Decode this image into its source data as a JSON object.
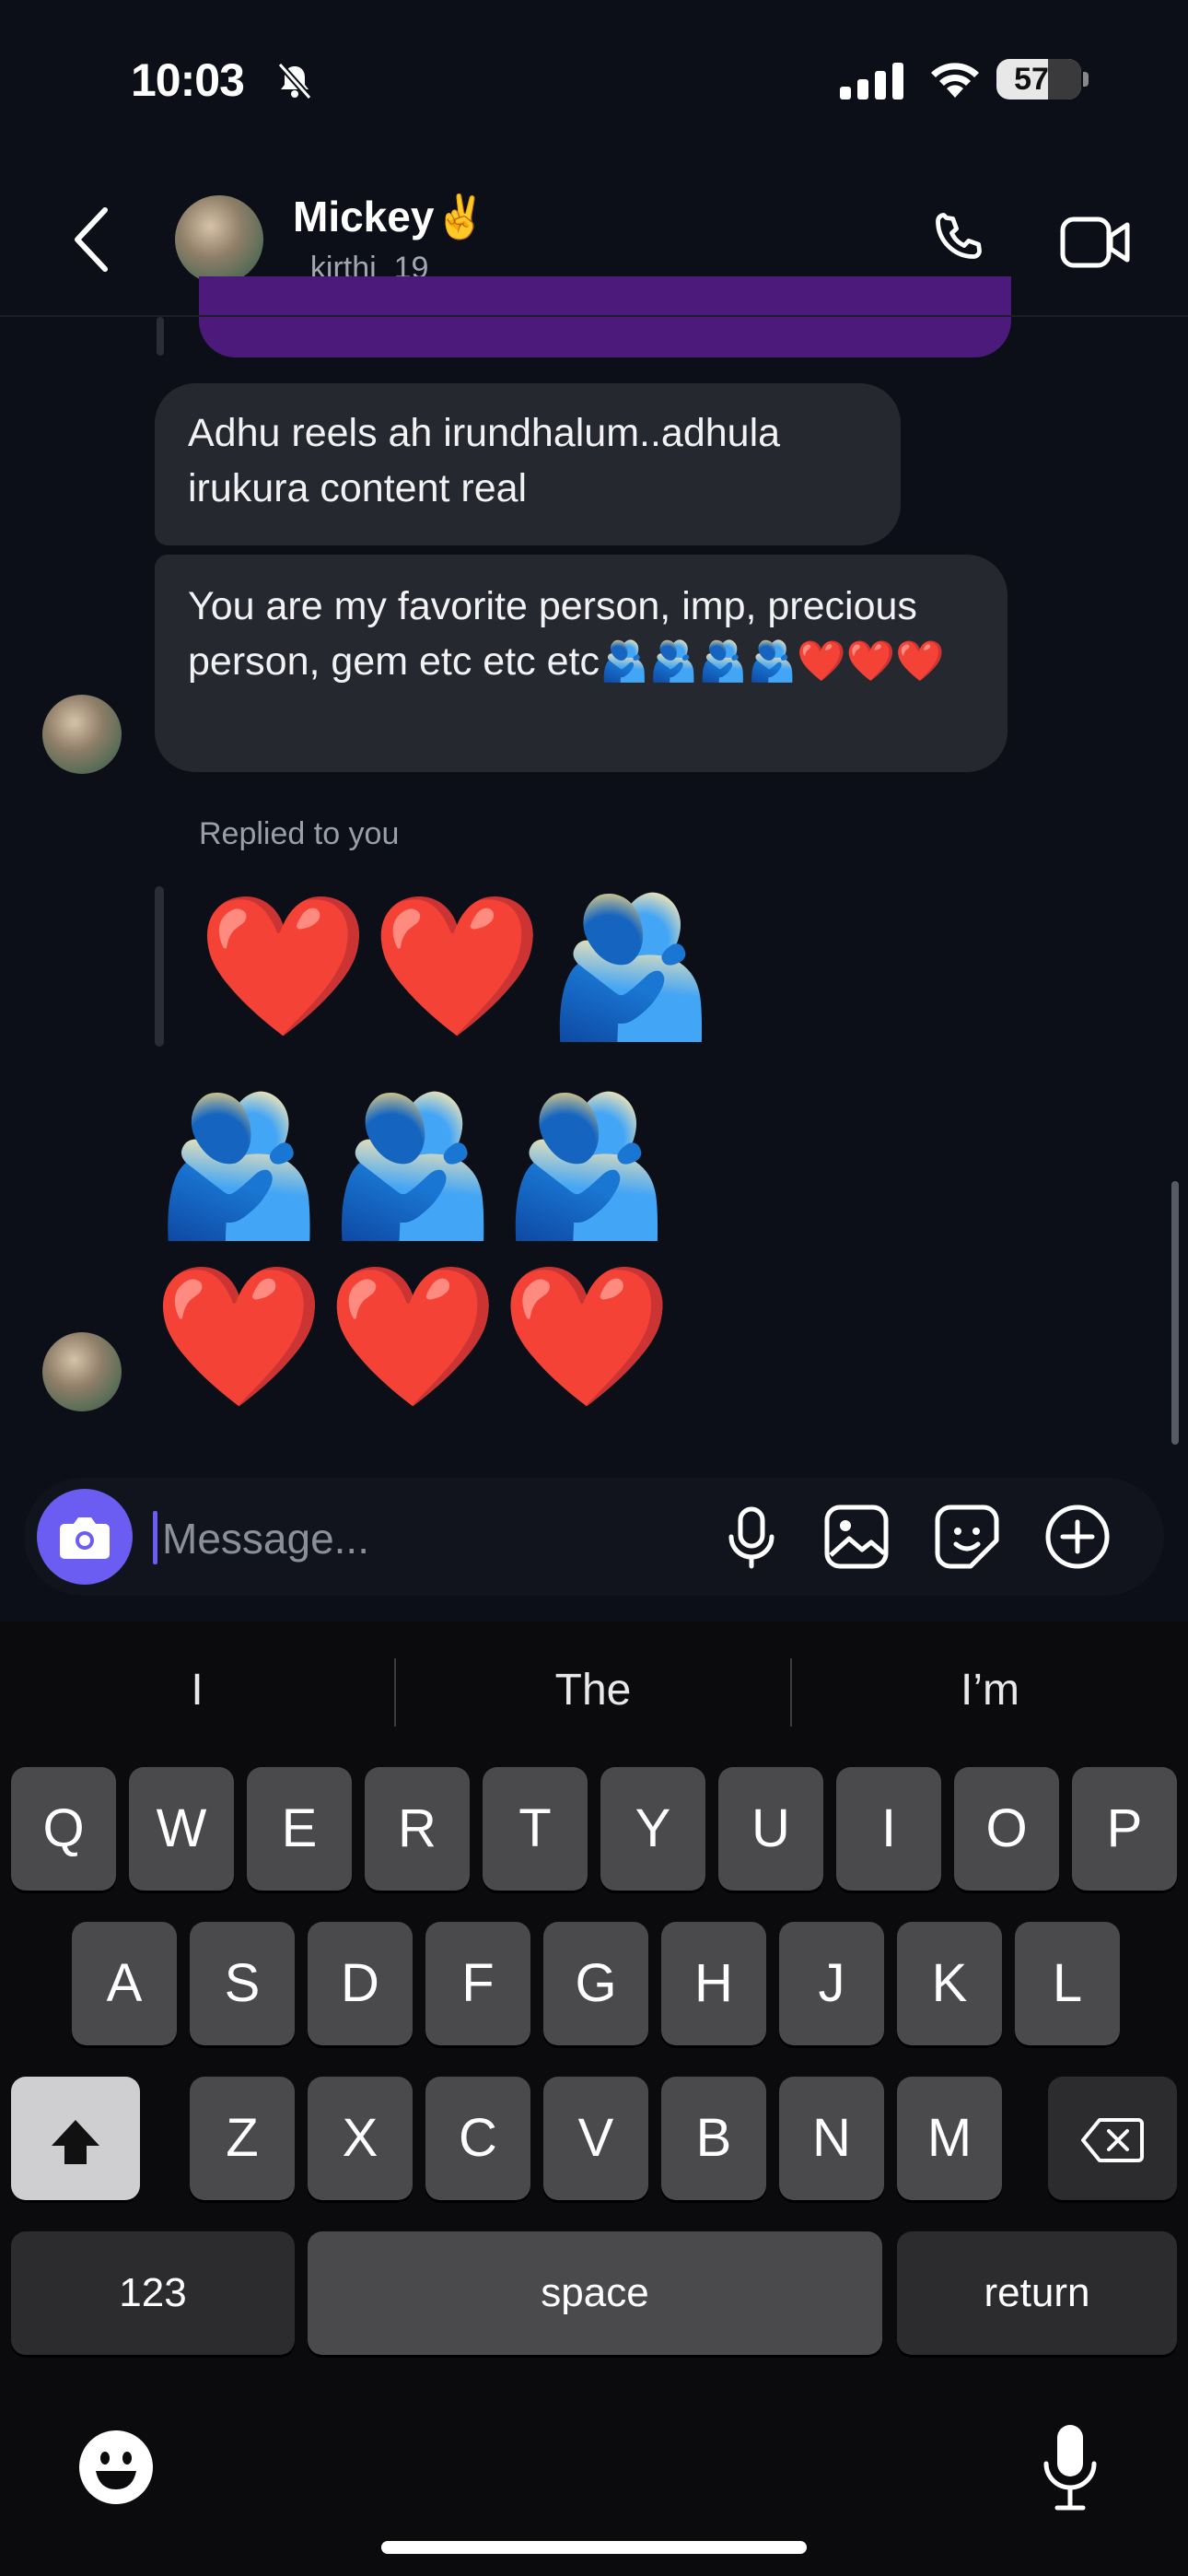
{
  "status_bar": {
    "time": "10:03",
    "battery": "57",
    "icons": [
      "bell-slash-icon",
      "cellular-signal-icon",
      "wifi-icon",
      "battery-icon"
    ]
  },
  "header": {
    "name": "Mickey✌️",
    "username": "_kirthi_19",
    "icons": [
      "back-chevron-icon",
      "phone-icon",
      "video-camera-icon"
    ]
  },
  "messages": {
    "msg1": "Adhu reels ah irundhalum..adhula irukura content real",
    "msg2": "You are my favorite person, imp, precious person, gem etc etc etc🫂🫂🫂🫂❤️❤️❤️",
    "replied_label": "Replied to you",
    "reply_emoji": "❤️❤️🫂",
    "emoji_line_1": "🫂🫂🫂",
    "emoji_line_2": "❤️❤️❤️"
  },
  "composer": {
    "placeholder": "Message...",
    "icons": [
      "camera-icon",
      "microphone-icon",
      "gallery-icon",
      "sticker-icon",
      "plus-circle-icon"
    ]
  },
  "keyboard": {
    "suggestions": [
      "I",
      "The",
      "I’m"
    ],
    "row1": [
      "Q",
      "W",
      "E",
      "R",
      "T",
      "Y",
      "U",
      "I",
      "O",
      "P"
    ],
    "row2": [
      "A",
      "S",
      "D",
      "F",
      "G",
      "H",
      "J",
      "K",
      "L"
    ],
    "row3": [
      "Z",
      "X",
      "C",
      "V",
      "B",
      "N",
      "M"
    ],
    "numbers_label": "123",
    "space_label": "space",
    "return_label": "return",
    "icons": [
      "shift-icon",
      "delete-icon",
      "emoji-icon",
      "dictation-mic-icon"
    ]
  },
  "colors": {
    "accent": "#6b5cf2",
    "bubble": "#26282f",
    "background": "#0c0f18",
    "keyboard": "#0b0b0d"
  }
}
